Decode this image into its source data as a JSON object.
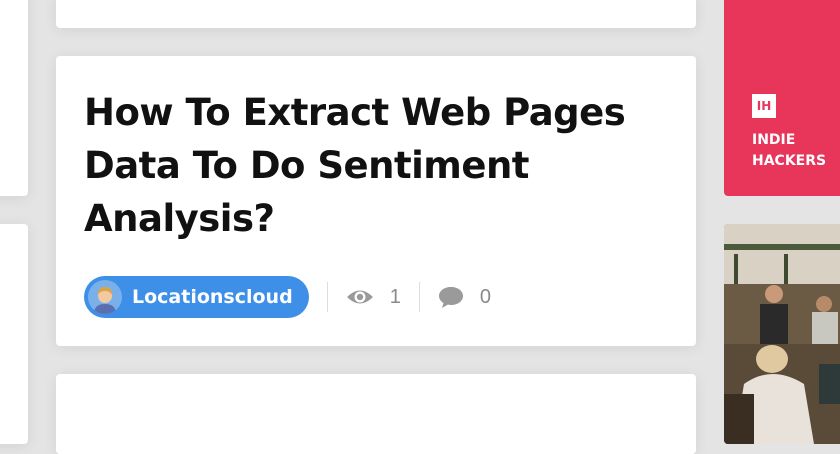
{
  "post": {
    "title": "How To Extract Web Pages Data To Do Sentiment Analysis?",
    "author": "Locationscloud",
    "views": "1",
    "comments": "0"
  },
  "sidebar_ad": {
    "logo_text": "IH",
    "line1": "INDIE",
    "line2": "HACKERS",
    "color": "#e8355a"
  },
  "colors": {
    "author_pill": "#3d8fe8",
    "background": "#e4e4e4"
  },
  "icons": [
    "avatar",
    "eye-icon",
    "comment-icon"
  ]
}
